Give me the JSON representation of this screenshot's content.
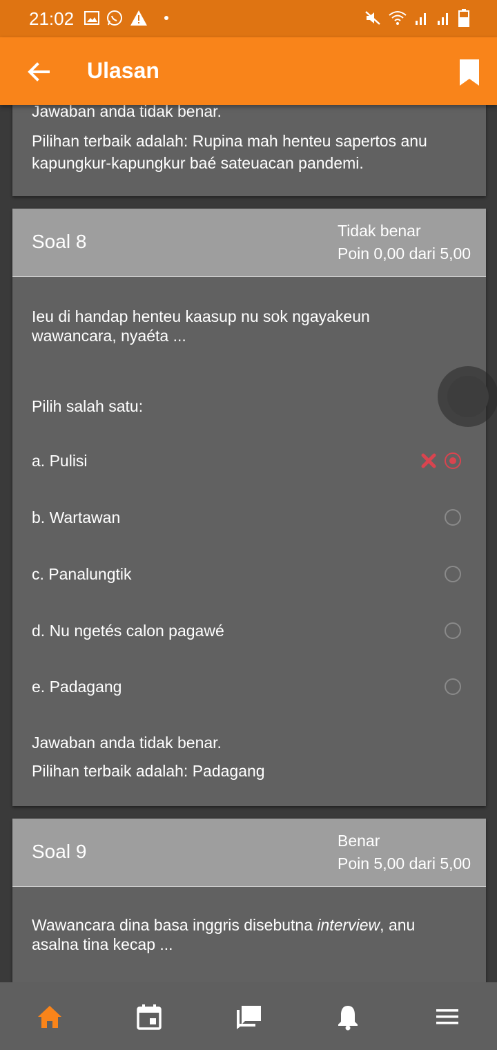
{
  "status_bar": {
    "time": "21:02",
    "left_icons": [
      "image-icon",
      "whatsapp-icon",
      "warning-icon",
      "dot"
    ],
    "right_icons": [
      "mute-icon",
      "wifi-icon",
      "signal-icon",
      "signal-icon",
      "battery-icon"
    ]
  },
  "appbar": {
    "title": "Ulasan",
    "back_icon": "arrow-left-icon",
    "bookmark_icon": "bookmark-icon"
  },
  "prev_feedback": {
    "line1": "Jawaban anda tidak benar.",
    "line2": "Pilihan terbaik adalah: Rupina mah henteu sapertos anu kapungkur-kapungkur baé sateuacan pandemi."
  },
  "q8": {
    "title": "Soal 8",
    "status": "Tidak benar",
    "points": "Poin 0,00 dari 5,00",
    "question": "Ieu di handap henteu kaasup nu sok ngayakeun wawancara, nyaéta ...",
    "choose": "Pilih salah satu:",
    "options": [
      {
        "label": "a. Pulisi",
        "selected": true,
        "wrong": true
      },
      {
        "label": "b. Wartawan",
        "selected": false
      },
      {
        "label": "c. Panalungtik",
        "selected": false
      },
      {
        "label": "d. Nu ngetés calon pagawé",
        "selected": false
      },
      {
        "label": "e. Padagang",
        "selected": false
      }
    ],
    "feedback1": "Jawaban anda tidak benar.",
    "feedback2": "Pilihan terbaik adalah: Padagang"
  },
  "q9": {
    "title": "Soal 9",
    "status": "Benar",
    "points": "Poin 5,00 dari 5,00",
    "question_pre": "Wawancara dina basa inggris disebutna ",
    "question_em": "interview",
    "question_post": ", anu asalna tina kecap ..."
  },
  "bottom_nav": [
    "home-icon",
    "calendar-icon",
    "messages-icon",
    "bell-icon",
    "menu-icon"
  ],
  "colors": {
    "accent": "#f9841a",
    "statusbar": "#df7412",
    "wrong": "#d9444f"
  }
}
